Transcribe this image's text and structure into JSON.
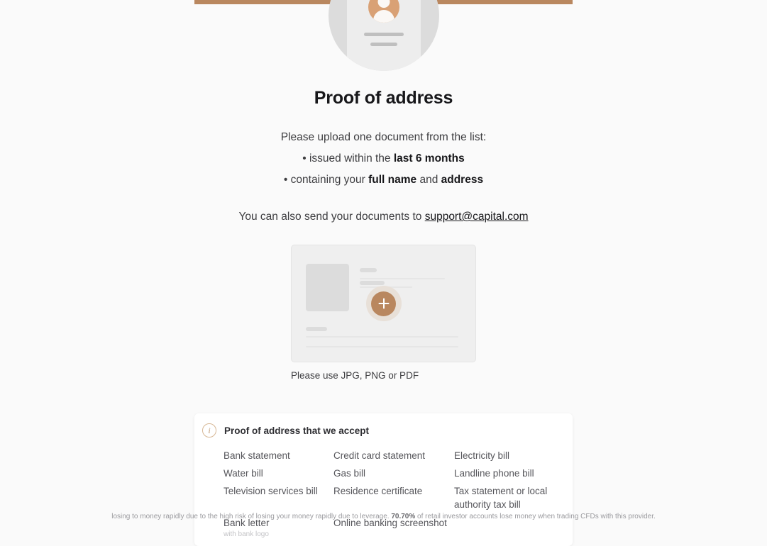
{
  "progress": {
    "percent": 100,
    "fill_color": "#b9875f",
    "track_color": "#efefef"
  },
  "hero": {
    "icon": "id-document-illustration",
    "circle_color": "#dcdcdc",
    "card_color": "#ededed",
    "avatar_color": "#d9a175"
  },
  "page": {
    "title": "Proof of address",
    "lead": "Please upload one document from the list:",
    "bullets": [
      {
        "mark": "•",
        "prefix": "issued within the ",
        "bold1": "last 6 months",
        "middle": "",
        "bold2": "",
        "suffix": ""
      },
      {
        "mark": "•",
        "prefix": "containing your ",
        "bold1": "full name",
        "middle": " and ",
        "bold2": "address",
        "suffix": ""
      }
    ],
    "contact_prefix": "You can also send your documents to ",
    "contact_email": "support@capital.com"
  },
  "upload": {
    "icon": "plus-icon",
    "button_label": "+",
    "caption": "Please use JPG, PNG or PDF",
    "accent_color": "#b9875f",
    "halo_color": "#e8e0d8",
    "box_color": "#efefef"
  },
  "info": {
    "icon": "info-icon",
    "icon_glyph": "i",
    "title": "Proof of address that we accept",
    "documents": [
      {
        "label": "Bank statement",
        "sub": ""
      },
      {
        "label": "Credit card statement",
        "sub": ""
      },
      {
        "label": "Electricity bill",
        "sub": ""
      },
      {
        "label": "Water bill",
        "sub": ""
      },
      {
        "label": "Gas bill",
        "sub": ""
      },
      {
        "label": "Landline phone bill",
        "sub": ""
      },
      {
        "label": "Television services bill",
        "sub": ""
      },
      {
        "label": "Residence certificate",
        "sub": ""
      },
      {
        "label": "Tax statement or local authority tax bill",
        "sub": ""
      },
      {
        "label": "Bank letter",
        "sub": "with bank logo"
      },
      {
        "label": "Online banking screenshot",
        "sub": ""
      },
      {
        "label": "",
        "sub": ""
      }
    ]
  },
  "disclaimer": {
    "prefix": "losing to money rapidly due to the high risk of losing your money rapidly due to leverage. ",
    "percent": "70.70%",
    "suffix": " of retail investor accounts lose money when trading CFDs with this provider."
  }
}
